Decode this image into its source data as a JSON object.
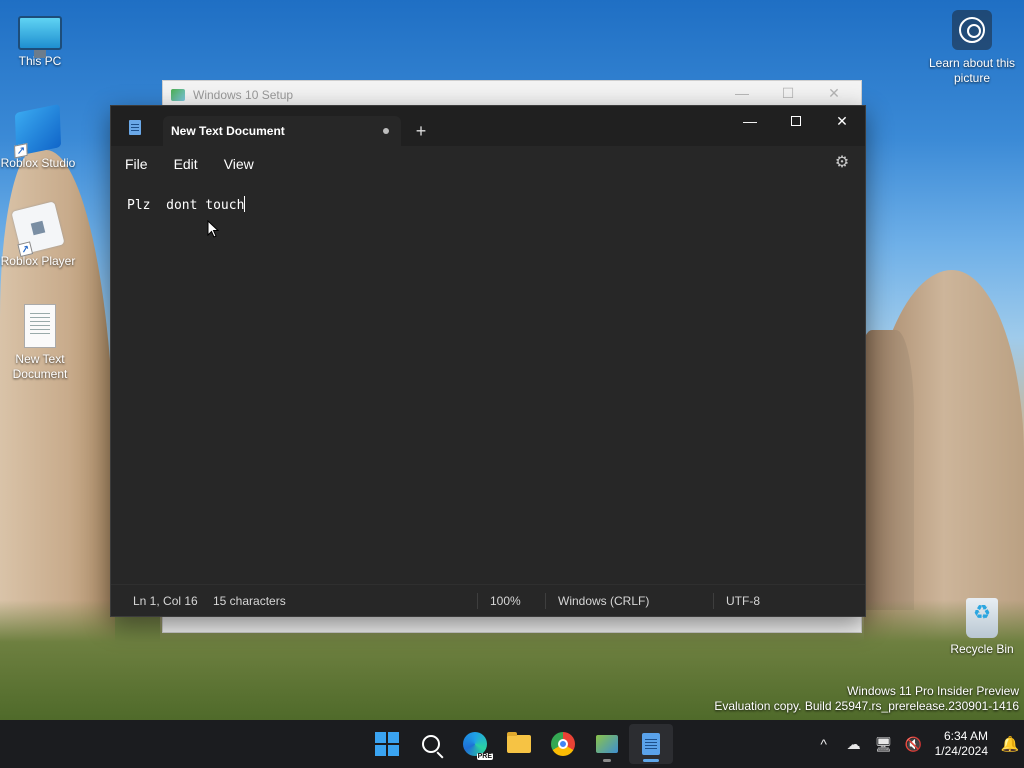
{
  "desktop": {
    "icons": [
      {
        "label": "This PC"
      },
      {
        "label": "Roblox Studio"
      },
      {
        "label": "Roblox Player"
      },
      {
        "label": "New Text Document"
      },
      {
        "label": "Recycle Bin"
      }
    ],
    "learn_about_picture": "Learn about this picture",
    "watermark": {
      "line1": "Windows 11 Pro Insider Preview",
      "line2": "Evaluation copy. Build 25947.rs_prerelease.230901-1416"
    }
  },
  "setup_window": {
    "title": "Windows 10 Setup",
    "minimize": "—",
    "maximize": "☐",
    "close": "✕"
  },
  "notepad": {
    "tab_title": "New Text Document",
    "new_tab": "+",
    "controls": {
      "minimize": "—",
      "close": "✕"
    },
    "menu": {
      "file": "File",
      "edit": "Edit",
      "view": "View"
    },
    "settings_icon": "gear-icon",
    "content": "Plz  dont touch",
    "status": {
      "position": "Ln 1, Col 16",
      "characters": "15 characters",
      "zoom": "100%",
      "line_endings": "Windows (CRLF)",
      "encoding": "UTF-8"
    }
  },
  "taskbar": {
    "apps": [
      "start",
      "search",
      "edge-preview",
      "file-explorer",
      "chrome",
      "windows-setup",
      "notepad"
    ],
    "tray": {
      "overflow": "^",
      "time": "6:34 AM",
      "date": "1/24/2024"
    }
  },
  "colors": {
    "notepad_bg": "#272727",
    "titlebar_bg": "#202020",
    "taskbar_bg": "#1b1c1f",
    "accent": "#3aa4f2"
  }
}
